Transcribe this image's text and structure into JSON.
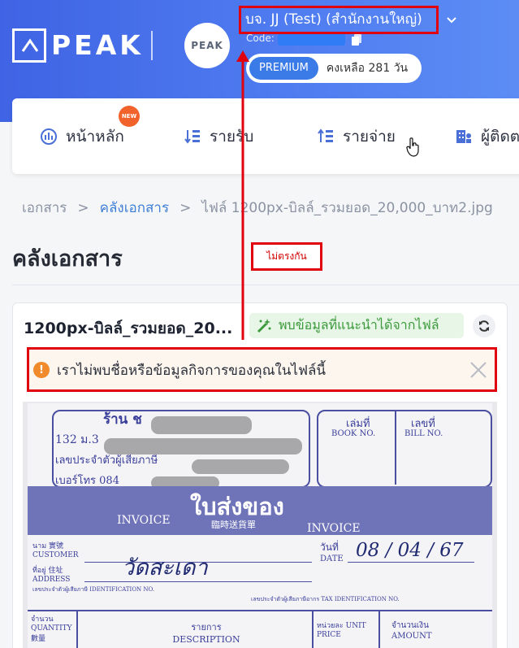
{
  "header": {
    "logo_text": "PEAK",
    "avatar_logo_text": "PEAK",
    "company_name": "บจ. JJ (Test) (สำนักงานใหญ่)",
    "code_label": "Code:",
    "plan_badge": "PREMIUM",
    "remaining_text": "คงเหลือ 281 วัน"
  },
  "nav": {
    "new_badge": "NEW",
    "items": [
      {
        "label": "หน้าหลัก",
        "icon": "dashboard-icon"
      },
      {
        "label": "รายรับ",
        "icon": "income-icon"
      },
      {
        "label": "รายจ่าย",
        "icon": "expense-icon"
      },
      {
        "label": "ผู้ติดต",
        "icon": "contacts-icon"
      }
    ]
  },
  "breadcrumb": {
    "items": [
      "เอกสาร",
      "คลังเอกสาร",
      "ไฟล์ 1200px-บิลล์_รวมยอด_20,000_บาท2.jpg"
    ],
    "separator": ">"
  },
  "page": {
    "title": "คลังเอกสาร"
  },
  "document": {
    "file_name": "1200px-บิลล์_รวมยอด_20...",
    "suggest_label": "พบข้อมูลที่แนะนำได้จากไฟล์",
    "warning_text": "เราไม่พบชื่อหรือข้อมูลกิจการของคุณในไฟล์นี้"
  },
  "receipt": {
    "shop_prefix": "ร้าน ช",
    "address_prefix": "132 ม.3",
    "tax_id_label": "เลขประจำตัวผู้เสียภาษี",
    "phone_prefix": "เบอร์โทร 084",
    "book_no_th": "เล่มที่",
    "book_no_en": "BOOK NO.",
    "bill_no_th": "เลขที่",
    "bill_no_en": "BILL NO.",
    "title_th": "ใบส่งของ",
    "title_cn": "臨時送貨單",
    "invoice_left": "INVOICE",
    "invoice_right": "INVOICE",
    "customer_label": "นาม 實號 CUSTOMER",
    "address_label": "ที่อยู่ 住址 ADDRESS",
    "customer_handwritten": "วัดสะเดา",
    "date_label_th": "วันที่",
    "date_label_en": "DATE",
    "date_handwritten": "08 / 04 / 67",
    "id_label": "เลขประจำตัวผู้เสียภาษี IDENTIFICATION NO.",
    "tax_label": "เลขประจำตัวผู้เสียภาษีอากร TAX IDENTIFICATION NO.",
    "col_qty": "จำนวน QUANTITY 數量",
    "col_desc": "รายการ DESCRIPTION",
    "col_unit": "หน่วยละ UNIT PRICE",
    "col_amount": "จำนวนเงิน AMOUNT"
  },
  "annotation": {
    "label": "ไม่ตรงกัน"
  },
  "colors": {
    "header_start": "#3f63e4",
    "header_end": "#5c8cf4",
    "accent": "#3b7be8",
    "annotation": "#e0000e",
    "warning": "#f08a2a",
    "success": "#3c9a3c"
  }
}
